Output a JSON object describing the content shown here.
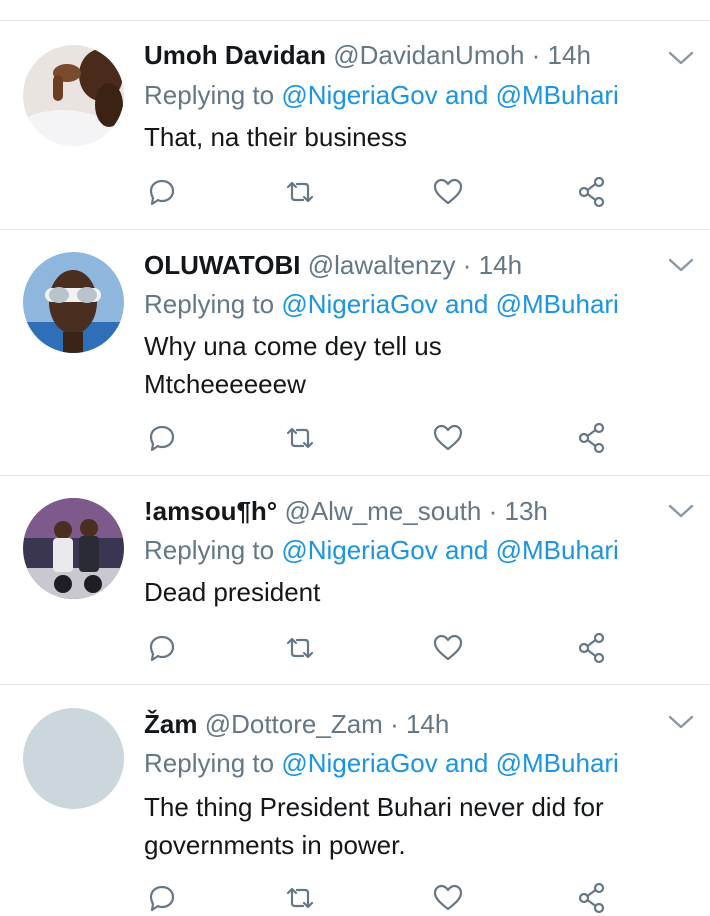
{
  "tweets": [
    {
      "name": "Umoh Davidan",
      "handle": "@DavidanUmoh",
      "dot": "·",
      "time": "14h",
      "replying_prefix": "Replying to",
      "reply_user_1": "@NigeriaGov",
      "reply_and": "and",
      "reply_user_2": "@MBuhari",
      "lines": [
        "That, na their business"
      ]
    },
    {
      "name": "OLUWATOBI",
      "handle": "@lawaltenzy",
      "dot": "·",
      "time": "14h",
      "replying_prefix": "Replying to",
      "reply_user_1": "@NigeriaGov",
      "reply_and": "and",
      "reply_user_2": "@MBuhari",
      "lines": [
        "Why una come dey tell us",
        "Mtcheeeeeew"
      ]
    },
    {
      "name": "!amsou¶h°",
      "handle": "@Alw_me_south",
      "dot": "·",
      "time": "13h",
      "replying_prefix": "Replying to",
      "reply_user_1": "@NigeriaGov",
      "reply_and": "and",
      "reply_user_2": "@MBuhari",
      "lines": [
        "Dead president"
      ]
    },
    {
      "name": "Žam",
      "handle": "@Dottore_Zam",
      "dot": "·",
      "time": "14h",
      "replying_prefix": "Replying to",
      "reply_user_1": "@NigeriaGov",
      "reply_and": "and",
      "reply_user_2": "@MBuhari",
      "lines": [
        "The thing President Buhari never did for",
        "governments in power."
      ]
    }
  ],
  "icons": {
    "reply": "comment-bubble-icon",
    "retweet": "retweet-icon",
    "like": "heart-icon",
    "share": "share-icon",
    "menu": "chevron-down-icon"
  },
  "colors": {
    "name": "#14171a",
    "muted": "#657786",
    "link": "#1b95e0",
    "icon": "#657786",
    "divider": "#e6ecf0",
    "placeholder_avatar": "#ccd6dd"
  }
}
